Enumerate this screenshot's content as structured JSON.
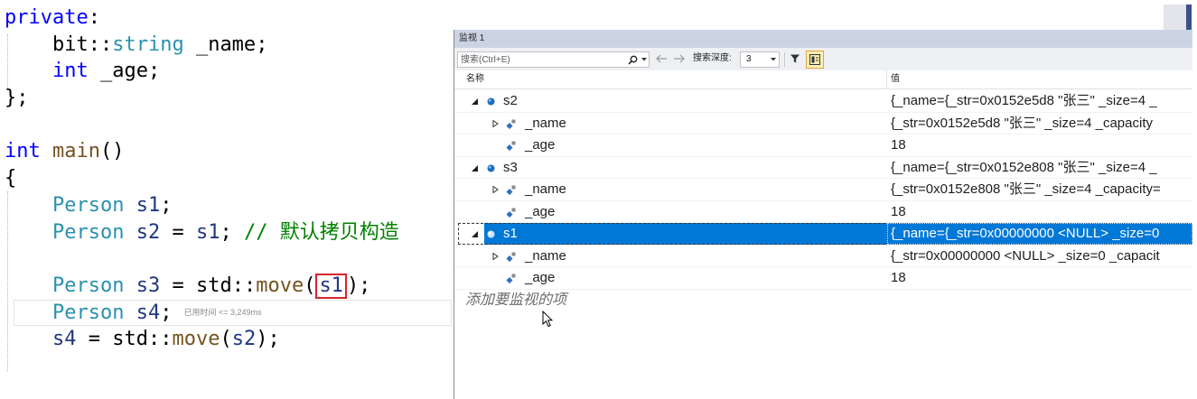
{
  "editor": {
    "lines": [
      [
        "private",
        ":"
      ],
      [
        "bit",
        "::",
        "string",
        " _name",
        ";"
      ],
      [
        "int",
        " _age",
        ";"
      ],
      [
        "};"
      ],
      [],
      [
        "int",
        " main",
        "()"
      ],
      [
        "{"
      ],
      [
        "Person",
        " s1",
        ";"
      ],
      [
        "Person",
        " s2",
        " = ",
        "s1",
        "; ",
        "// 默认拷贝构造"
      ],
      [],
      [
        "Person",
        " s3",
        " = ",
        "std",
        "::",
        "move",
        "(",
        "s1",
        ");"
      ],
      [
        "Person",
        " s4",
        ";"
      ],
      [
        "s4",
        " = ",
        "std",
        "::",
        "move",
        "(",
        "s2",
        ");"
      ]
    ],
    "perf_tip": "已用时间 <= 3,249ms",
    "highlight_color": "#d9242a"
  },
  "watch": {
    "title": "监视 1",
    "toolbar": {
      "search_placeholder": "搜索(Ctrl+E)",
      "search_icon": "search-icon",
      "search_dropdown_icon": "chevron-down-icon",
      "back_icon": "arrow-left-icon",
      "forward_icon": "arrow-right-icon",
      "depth_label": "搜索深度:",
      "depth_value": "3",
      "depth_dropdown_icon": "chevron-down-icon",
      "filter_icon": "filter-icon",
      "toggle_icon": "toggle-view-icon"
    },
    "columns": {
      "name": "名称",
      "value": "值"
    },
    "rows": [
      {
        "name": "s2",
        "value": "{_name={_str=0x0152e5d8 \"张三\" _size=4 _",
        "expander": "expanded-arrow-icon",
        "icon": "variable-icon"
      },
      {
        "name": "_name",
        "value": "{_str=0x0152e5d8 \"张三\" _size=4 _capacity",
        "expander": "collapsed-arrow-icon",
        "icon": "field-icon"
      },
      {
        "name": "_age",
        "value": "18",
        "icon": "field-icon"
      },
      {
        "name": "s3",
        "value": "{_name={_str=0x0152e808 \"张三\" _size=4 _",
        "expander": "expanded-arrow-icon",
        "icon": "variable-icon"
      },
      {
        "name": "_name",
        "value": "{_str=0x0152e808 \"张三\" _size=4 _capacity=",
        "expander": "collapsed-arrow-icon",
        "icon": "field-icon"
      },
      {
        "name": "_age",
        "value": "18",
        "icon": "field-icon"
      },
      {
        "name": "s1",
        "value": "{_name={_str=0x00000000 <NULL> _size=0",
        "expander": "expanded-arrow-icon",
        "icon": "variable-icon",
        "selected": true
      },
      {
        "name": "_name",
        "value": "{_str=0x00000000 <NULL> _size=0 _capacit",
        "expander": "collapsed-arrow-icon",
        "icon": "field-icon"
      },
      {
        "name": "_age",
        "value": "18",
        "icon": "field-icon"
      }
    ],
    "add_item_placeholder": "添加要监视的项",
    "selection_color": "#0078d7"
  }
}
